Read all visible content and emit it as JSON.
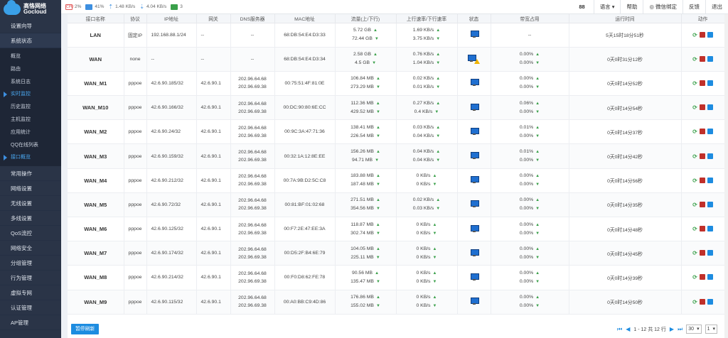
{
  "logo": {
    "cn": "高恪网络",
    "en": "Gocloud"
  },
  "sidebar": {
    "items_top": [
      "设置向导",
      "系统状态"
    ],
    "submenu": [
      "概览",
      "路由",
      "系统日志",
      "实时监控",
      "历史监控",
      "主机监控",
      "应用统计",
      "QQ在线列表",
      "接口概览"
    ],
    "active_indices": [
      3,
      8
    ],
    "items_bottom": [
      "常用操作",
      "网络设置",
      "无线设置",
      "多线设置",
      "QoS流控",
      "网络安全",
      "分组管理",
      "行为管理",
      "虚拟专网",
      "认证管理",
      "AP管理"
    ]
  },
  "topbar": {
    "cpu": "2%",
    "mem": "41%",
    "up": "1.48 KB/s",
    "down": "4.04 KB/s",
    "terminals": "3",
    "count": "88",
    "lang": "语言",
    "help": "帮助",
    "wechat": "微信绑定",
    "feedback": "反馈",
    "logout": "退出"
  },
  "table": {
    "headers": [
      "接口名称",
      "协议",
      "IP地址",
      "网关",
      "DNS服务器",
      "MAC地址",
      "流量(上/下行)",
      "上行速率/下行速率",
      "状态",
      "带宽占用",
      "运行时间",
      "动作"
    ],
    "rows": [
      {
        "name": "LAN",
        "proto": "固定IP",
        "ip": "192.168.88.1/24",
        "gw": "--",
        "dns": [
          "--"
        ],
        "mac": "68:DB:54:E4:D3:33",
        "traffic": [
          "5.72 GB",
          "72.44 GB"
        ],
        "rate": [
          "1.69 KB/s",
          "3.75 KB/s"
        ],
        "warn": false,
        "bw": [
          "--"
        ],
        "uptime": "5天15时18分51秒"
      },
      {
        "name": "WAN",
        "proto": "none",
        "ip": "--",
        "gw": "--",
        "dns": [
          "--"
        ],
        "mac": "68:DB:54:E4:D3:34",
        "traffic": [
          "2.58 GB",
          "4.5 GB"
        ],
        "rate": [
          "0.76 KB/s",
          "1.04 KB/s"
        ],
        "warn": true,
        "bw": [
          "0.00%",
          "0.00%"
        ],
        "uptime": "0天0时31分12秒"
      },
      {
        "name": "WAN_M1",
        "proto": "pppoe",
        "ip": "42.6.90.185/32",
        "gw": "42.6.90.1",
        "dns": [
          "202.96.64.68",
          "202.96.69.38"
        ],
        "mac": "00:75:51:4F:81:0E",
        "traffic": [
          "106.84 MB",
          "273.29 MB"
        ],
        "rate": [
          "0.02 KB/s",
          "0.01 KB/s"
        ],
        "warn": false,
        "bw": [
          "0.00%",
          "0.00%"
        ],
        "uptime": "0天0时14分52秒"
      },
      {
        "name": "WAN_M10",
        "proto": "pppoe",
        "ip": "42.6.90.166/32",
        "gw": "42.6.90.1",
        "dns": [
          "202.96.64.68",
          "202.96.69.38"
        ],
        "mac": "00:DC:90:80:6E:CC",
        "traffic": [
          "112.36 MB",
          "429.52 MB"
        ],
        "rate": [
          "0.27 KB/s",
          "0.4 KB/s"
        ],
        "warn": false,
        "bw": [
          "0.06%",
          "0.00%"
        ],
        "uptime": "0天0时14分54秒"
      },
      {
        "name": "WAN_M2",
        "proto": "pppoe",
        "ip": "42.6.90.24/32",
        "gw": "42.6.90.1",
        "dns": [
          "202.96.64.68",
          "202.96.69.38"
        ],
        "mac": "00:9C:3A:47:71:36",
        "traffic": [
          "138.41 MB",
          "226.54 MB"
        ],
        "rate": [
          "0.03 KB/s",
          "0.04 KB/s"
        ],
        "warn": false,
        "bw": [
          "0.01%",
          "0.00%"
        ],
        "uptime": "0天0时14分37秒"
      },
      {
        "name": "WAN_M3",
        "proto": "pppoe",
        "ip": "42.6.90.159/32",
        "gw": "42.6.90.1",
        "dns": [
          "202.96.64.68",
          "202.96.69.38"
        ],
        "mac": "00:32:1A:12:8E:EE",
        "traffic": [
          "156.26 MB",
          "94.71 MB"
        ],
        "rate": [
          "0.04 KB/s",
          "0.04 KB/s"
        ],
        "warn": false,
        "bw": [
          "0.01%",
          "0.00%"
        ],
        "uptime": "0天0时14分42秒"
      },
      {
        "name": "WAN_M4",
        "proto": "pppoe",
        "ip": "42.6.90.212/32",
        "gw": "42.6.90.1",
        "dns": [
          "202.96.64.68",
          "202.96.69.38"
        ],
        "mac": "00:7A:9B:D2:5C:C8",
        "traffic": [
          "183.88 MB",
          "187.48 MB"
        ],
        "rate": [
          "0 KB/s",
          "0 KB/s"
        ],
        "warn": false,
        "bw": [
          "0.00%",
          "0.00%"
        ],
        "uptime": "0天0时14分56秒"
      },
      {
        "name": "WAN_M5",
        "proto": "pppoe",
        "ip": "42.6.90.72/32",
        "gw": "42.6.90.1",
        "dns": [
          "202.96.64.68",
          "202.96.69.38"
        ],
        "mac": "00:81:BF:01:02:68",
        "traffic": [
          "271.51 MB",
          "354.56 MB"
        ],
        "rate": [
          "0.02 KB/s",
          "0.03 KB/s"
        ],
        "warn": false,
        "bw": [
          "0.00%",
          "0.00%"
        ],
        "uptime": "0天0时14分35秒"
      },
      {
        "name": "WAN_M6",
        "proto": "pppoe",
        "ip": "42.6.90.125/32",
        "gw": "42.6.90.1",
        "dns": [
          "202.96.64.68",
          "202.96.69.38"
        ],
        "mac": "00:F7:2E:47:EE:3A",
        "traffic": [
          "118.87 MB",
          "302.74 MB"
        ],
        "rate": [
          "0 KB/s",
          "0 KB/s"
        ],
        "warn": false,
        "bw": [
          "0.00%",
          "0.00%"
        ],
        "uptime": "0天0时14分48秒"
      },
      {
        "name": "WAN_M7",
        "proto": "pppoe",
        "ip": "42.6.90.174/32",
        "gw": "42.6.90.1",
        "dns": [
          "202.96.64.68",
          "202.96.69.38"
        ],
        "mac": "00:D5:2F:B4:6E:79",
        "traffic": [
          "104.05 MB",
          "225.11 MB"
        ],
        "rate": [
          "0 KB/s",
          "0 KB/s"
        ],
        "warn": false,
        "bw": [
          "0.00%",
          "0.00%"
        ],
        "uptime": "0天0时14分45秒"
      },
      {
        "name": "WAN_M8",
        "proto": "pppoe",
        "ip": "42.6.90.214/32",
        "gw": "42.6.90.1",
        "dns": [
          "202.96.64.68",
          "202.96.69.38"
        ],
        "mac": "00:F0:D8:62:FE:78",
        "traffic": [
          "90.56 MB",
          "135.47 MB"
        ],
        "rate": [
          "0 KB/s",
          "0 KB/s"
        ],
        "warn": false,
        "bw": [
          "0.00%",
          "0.00%"
        ],
        "uptime": "0天0时14分39秒"
      },
      {
        "name": "WAN_M9",
        "proto": "pppoe",
        "ip": "42.6.90.115/32",
        "gw": "42.6.90.1",
        "dns": [
          "202.96.64.68",
          "202.96.69.38"
        ],
        "mac": "00:A0:BB:C9:4D:86",
        "traffic": [
          "176.86 MB",
          "155.02 MB"
        ],
        "rate": [
          "0 KB/s",
          "0 KB/s"
        ],
        "warn": false,
        "bw": [
          "0.00%",
          "0.00%"
        ],
        "uptime": "0天0时14分50秒"
      }
    ]
  },
  "footer": {
    "pause_label": "暂停刷新",
    "pager_text": "1 - 12 共 12 行",
    "page_size": "30",
    "page": "1"
  },
  "colors": {
    "accent": "#1d8ce0",
    "sidebar": "#2a3447",
    "up_arrow": "#3aa04a"
  }
}
